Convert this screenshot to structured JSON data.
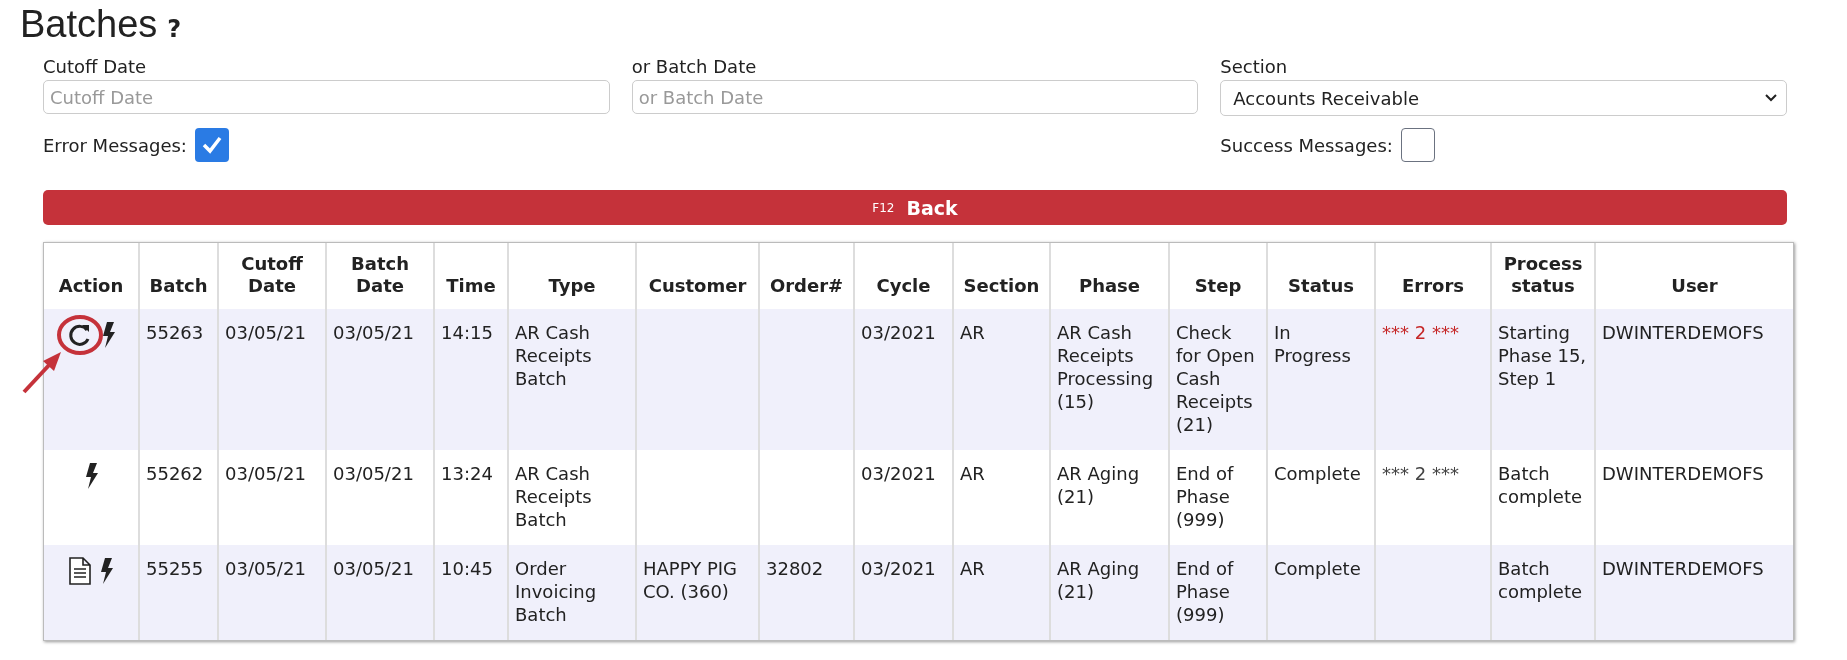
{
  "title": "Batches",
  "help": "?",
  "filters": {
    "cutoff": {
      "label": "Cutoff Date",
      "placeholder": "Cutoff Date"
    },
    "batch_date": {
      "label": "or Batch Date",
      "placeholder": "or Batch Date"
    },
    "section": {
      "label": "Section",
      "value": "Accounts Receivable"
    }
  },
  "options": [
    {
      "label": "Error Messages:",
      "checked": true
    },
    {
      "label": "Success Messages:",
      "checked": false
    }
  ],
  "back_button": {
    "key": "F12",
    "label": "Back"
  },
  "table": {
    "columns": [
      "Action",
      "Batch",
      "Cutoff Date",
      "Batch Date",
      "Time",
      "Type",
      "Customer",
      "Order#",
      "Cycle",
      "Section",
      "Phase",
      "Step",
      "Status",
      "Errors",
      "Process status",
      "User"
    ],
    "rows": [
      {
        "actions": [
          {
            "kind": "refresh",
            "highlighted": true
          },
          {
            "kind": "bolt",
            "highlighted": false
          }
        ],
        "batch": "55263",
        "cutoff": "03/05/21",
        "batch_date": "03/05/21",
        "time": "14:15",
        "type": "AR Cash Receipts Batch",
        "customer": "",
        "order": "",
        "cycle": "03/2021",
        "section": "AR",
        "phase": "AR Cash Receipts Processing (15)",
        "step": "Check for Open Cash Receipts (21)",
        "status": "In Progress",
        "errors": {
          "text": "*** 2 ***",
          "color": "#c62828"
        },
        "process_status": "Starting Phase 15, Step 1",
        "user": "DWINTERDEMOFS"
      },
      {
        "actions": [
          {
            "kind": "bolt",
            "highlighted": false
          }
        ],
        "batch": "55262",
        "cutoff": "03/05/21",
        "batch_date": "03/05/21",
        "time": "13:24",
        "type": "AR Cash Receipts Batch",
        "customer": "",
        "order": "",
        "cycle": "03/2021",
        "section": "AR",
        "phase": "AR Aging (21)",
        "step": "End of Phase (999)",
        "status": "Complete",
        "errors": {
          "text": "*** 2 ***",
          "color": "#444444"
        },
        "process_status": "Batch complete",
        "user": "DWINTERDEMOFS"
      },
      {
        "actions": [
          {
            "kind": "document",
            "highlighted": false
          },
          {
            "kind": "bolt",
            "highlighted": false
          }
        ],
        "batch": "55255",
        "cutoff": "03/05/21",
        "batch_date": "03/05/21",
        "time": "10:45",
        "type": "Order Invoicing Batch",
        "customer": "HAPPY PIG CO. (360)",
        "order": "32802",
        "cycle": "03/2021",
        "section": "AR",
        "phase": "AR Aging (21)",
        "step": "End of Phase (999)",
        "status": "Complete",
        "process_status": "Batch complete",
        "user": "DWINTERDEMOFS"
      }
    ]
  }
}
